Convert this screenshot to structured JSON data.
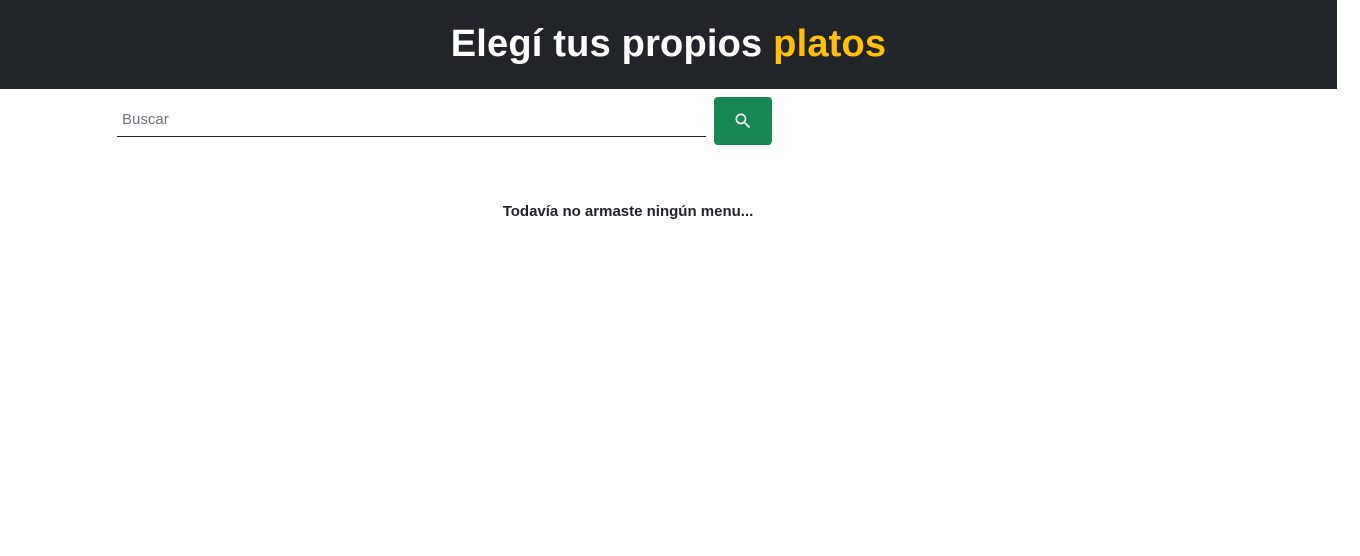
{
  "header": {
    "title_main": "Elegí tus propios",
    "title_accent": "platos",
    "background_color": "#212529",
    "accent_color": "#ffc107"
  },
  "search": {
    "placeholder": "Buscar",
    "value": "",
    "button_icon": "search-icon",
    "button_color": "#198754"
  },
  "menu": {
    "empty_message": "Todavía no armaste ningún menu..."
  }
}
